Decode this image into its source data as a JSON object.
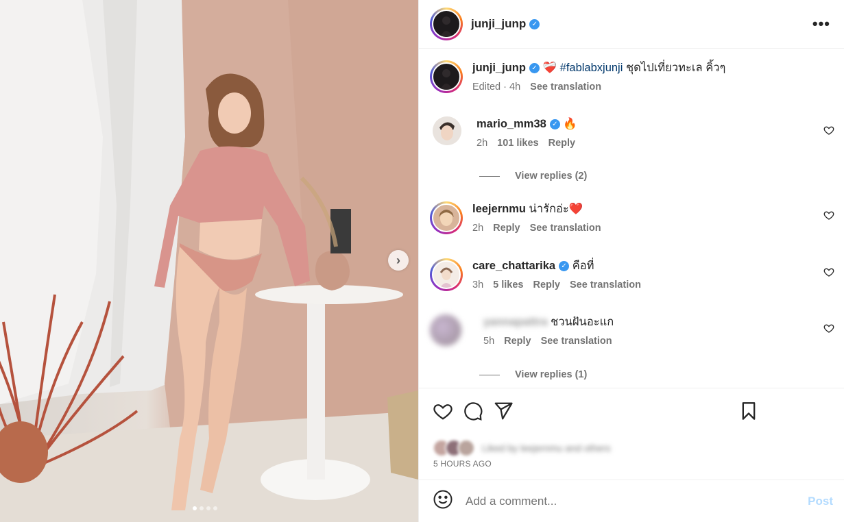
{
  "header": {
    "username": "junji_junp",
    "more_icon": "more-horizontal-icon"
  },
  "caption": {
    "username": "junji_junp",
    "emoji": "❤️‍🩹",
    "hashtag": "#fablabxjunji",
    "text": "ชุดไปเที่ยวทะเล คิ้วๆ",
    "edited": "Edited",
    "time": "4h",
    "see_translation": "See translation"
  },
  "comments": [
    {
      "username": "mario_mm38",
      "verified": true,
      "text": "🔥",
      "time": "2h",
      "likes": "101 likes",
      "reply": "Reply",
      "view_replies": "View replies (2)"
    },
    {
      "username": "leejernmu",
      "verified": false,
      "text": "น่ารักอ่ะ❤️",
      "time": "2h",
      "reply": "Reply",
      "see_translation": "See translation"
    },
    {
      "username": "care_chattarika",
      "verified": true,
      "text": "คือที่",
      "time": "3h",
      "likes": "5 likes",
      "reply": "Reply",
      "see_translation": "See translation"
    },
    {
      "username": "yannapattra",
      "verified": false,
      "text": "ชวนฝันอะแก",
      "time": "5h",
      "reply": "Reply",
      "see_translation": "See translation",
      "view_replies": "View replies (1)"
    }
  ],
  "actions": {
    "liked_by": "Liked by leejernmu and others",
    "time_ago": "5 HOURS AGO"
  },
  "add_comment": {
    "placeholder": "Add a comment...",
    "post": "Post"
  },
  "carousel": {
    "slides": 4,
    "active": 1
  },
  "colors": {
    "verified": "#3897f0",
    "post_disabled": "#b3dbff",
    "hashtag": "#00376b"
  }
}
